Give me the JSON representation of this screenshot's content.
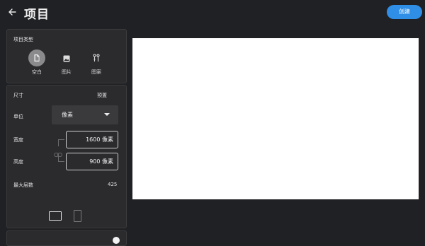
{
  "header": {
    "title": "项目",
    "create_label": "创建"
  },
  "project_type": {
    "heading": "项目类型",
    "options": [
      {
        "label": "空白",
        "icon": "file-icon",
        "selected": true
      },
      {
        "label": "图片",
        "icon": "image-icon",
        "selected": false
      },
      {
        "label": "图案",
        "icon": "pattern-icon",
        "selected": false
      }
    ]
  },
  "size": {
    "heading": "尺寸",
    "presets_label": "预置",
    "unit_label": "单位",
    "unit_value": "像素",
    "width_label": "宽度",
    "width_value": "1600 像素",
    "height_label": "高度",
    "height_value": "900 像素",
    "max_layers_label": "最大层数",
    "max_layers_value": "425"
  }
}
